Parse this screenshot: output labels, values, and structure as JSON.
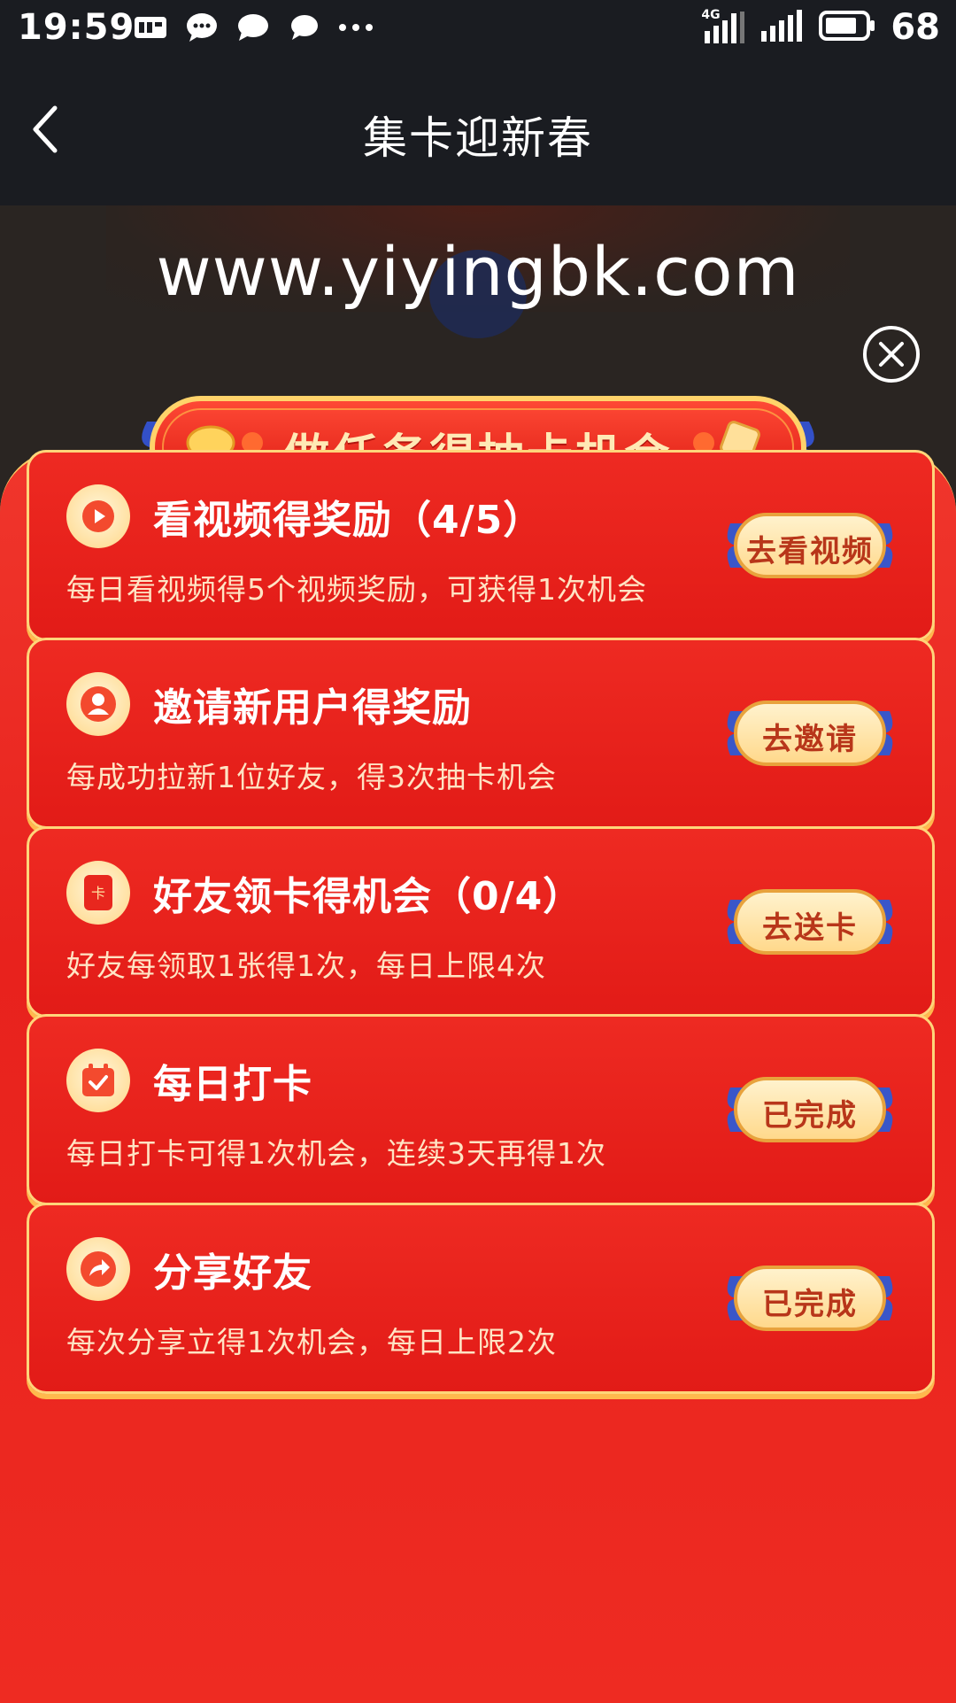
{
  "status_bar": {
    "time": "19:59",
    "network": "4G",
    "battery": "68",
    "icons": [
      "sim-card-icon",
      "message-bubble-icon",
      "chat-bubble-icon",
      "chat-bubble-icon",
      "more-dots-icon",
      "signal-icon",
      "signal-icon",
      "battery-icon"
    ]
  },
  "nav": {
    "title": "集卡迎新春",
    "back_icon": "back-arrow-icon"
  },
  "watermark": "www.yiyingbk.com",
  "close_icon": "close-icon",
  "banner": {
    "title": "做任务得抽卡机会"
  },
  "tasks": [
    {
      "icon": "play-icon",
      "title": "看视频得奖励（4/5）",
      "desc": "每日看视频得5个视频奖励，可获得1次机会",
      "button": "去看视频"
    },
    {
      "icon": "user-icon",
      "title": "邀请新用户得奖励",
      "desc": "每成功拉新1位好友，得3次抽卡机会",
      "button": "去邀请"
    },
    {
      "icon": "card-icon",
      "title": "好友领卡得机会（0/4）",
      "desc": "好友每领取1张得1次，每日上限4次",
      "button": "去送卡"
    },
    {
      "icon": "calendar-check-icon",
      "title": "每日打卡",
      "desc": "每日打卡可得1次机会，连续3天再得1次",
      "button": "已完成"
    },
    {
      "icon": "share-icon",
      "title": "分享好友",
      "desc": "每次分享立得1次机会，每日上限2次",
      "button": "已完成"
    }
  ],
  "colors": {
    "modal_red": "#e8221d",
    "card_border": "#ffd57a",
    "button_text": "#b8361a",
    "banner_text": "#ffe9b5"
  }
}
